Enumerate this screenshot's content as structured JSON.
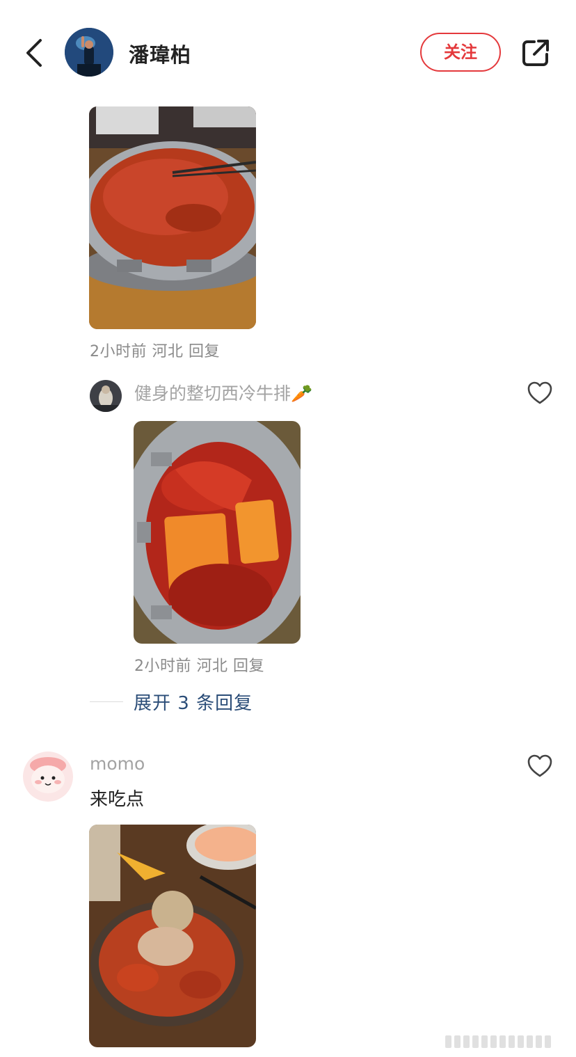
{
  "header": {
    "title": "潘瑋柏",
    "follow_label": "关注",
    "back_icon": "chevron-left-icon",
    "share_icon": "share-icon"
  },
  "comments": [
    {
      "image": "hotpot-red-broth-photo",
      "meta": {
        "time": "2小时前",
        "location": "河北",
        "reply_label": "回复"
      }
    },
    {
      "username": "健身的整切西冷牛排🥕",
      "image": "hotpot-butter-chili-photo",
      "meta": {
        "time": "2小时前",
        "location": "河北",
        "reply_label": "回复"
      },
      "expand_label": "展开 3 条回复"
    },
    {
      "username": "momo",
      "text": "来吃点",
      "image": "spicy-tripe-bowl-photo"
    }
  ],
  "colors": {
    "accent": "#e4393c",
    "link": "#2b4d78",
    "meta": "#8a8a8a"
  }
}
